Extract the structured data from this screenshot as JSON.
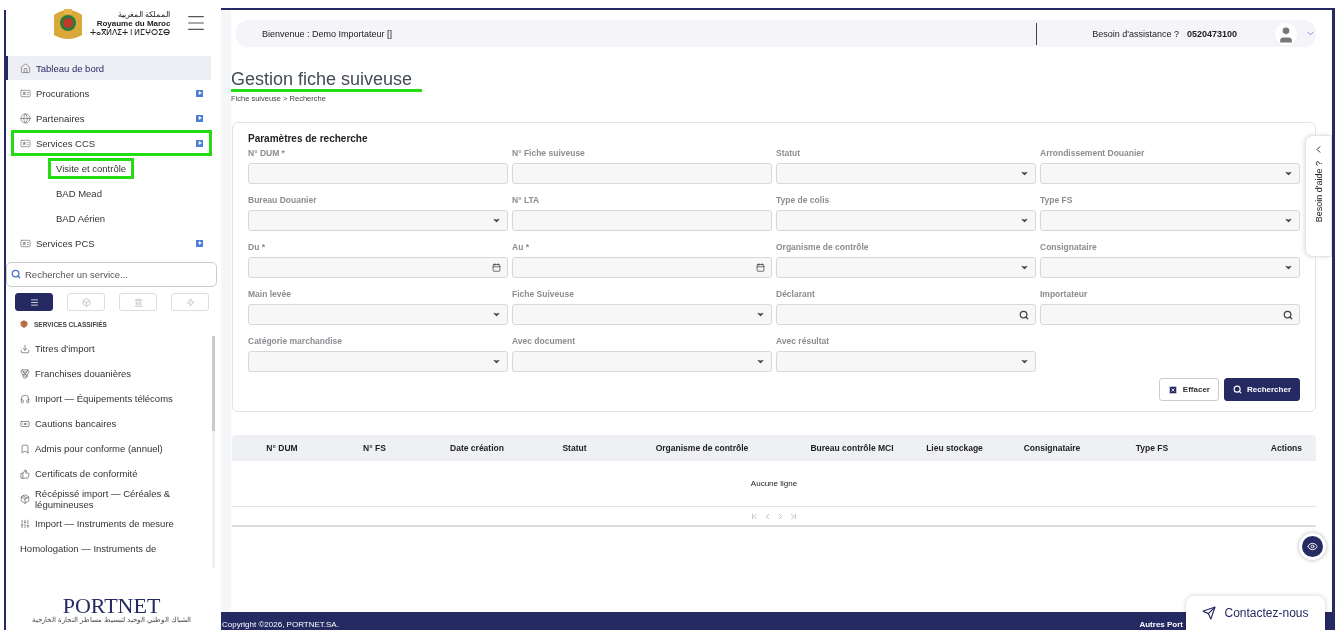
{
  "brand": {
    "arabic": "المملكة المغربية",
    "french": "Royaume du Maroc",
    "tifinagh": "ⵜⴰⴳⵍⴷⵉⵜ ⵏ ⵍⵎⵖⵔⵉⴱ"
  },
  "sidebar": {
    "menu": [
      {
        "label": "Tableau de bord",
        "selected": true,
        "highlighted": false,
        "expandable": false
      },
      {
        "label": "Procurations",
        "selected": false,
        "highlighted": false,
        "expandable": true
      },
      {
        "label": "Partenaires",
        "selected": false,
        "highlighted": false,
        "expandable": true
      },
      {
        "label": "Services CCS",
        "selected": false,
        "highlighted": true,
        "expandable": true,
        "children": [
          {
            "label": "Visite et contrôle",
            "highlighted": true
          },
          {
            "label": "BAD Mead",
            "highlighted": false
          },
          {
            "label": "BAD Aérien",
            "highlighted": false
          }
        ]
      },
      {
        "label": "Services PCS",
        "selected": false,
        "highlighted": false,
        "expandable": true
      }
    ],
    "search": {
      "placeholder": "Rechercher un service..."
    },
    "view_tabs": [
      {
        "selected": true
      },
      {
        "selected": false
      },
      {
        "selected": false
      },
      {
        "selected": false
      }
    ],
    "section_title": "SERVICES CLASSIFIÉS",
    "services": [
      "Titres d'import",
      "Franchises douanières",
      "Import — Équipements télécoms",
      "Cautions bancaires",
      "Admis pour conforme (annuel)",
      "Certificats de conformité",
      "Récépissé import — Céréales & légumineuses",
      "Import — Instruments de mesure",
      "Homologation — Instruments de"
    ],
    "footer_logo": {
      "name": "PORTNET",
      "subtitle": "الشباك الوطني الوحيد لتبسيط مساطر التجارة الخارجية"
    }
  },
  "header": {
    "welcome": "Bienvenue : Demo Importateur []",
    "help_label": "Besoin d'assistance ?",
    "phone": "0520473100"
  },
  "page": {
    "title": "Gestion fiche suiveuse",
    "title_highlighted": true,
    "breadcrumb": "Fiche suiveuse > Recherche"
  },
  "search_panel": {
    "title": "Paramètres de recherche",
    "fields": [
      {
        "label": "N° DUM *",
        "kind": "text"
      },
      {
        "label": "N° Fiche suiveuse",
        "kind": "text"
      },
      {
        "label": "Statut",
        "kind": "select"
      },
      {
        "label": "Arrondissement Douanier",
        "kind": "select"
      },
      {
        "label": "Bureau Douanier",
        "kind": "select"
      },
      {
        "label": "N° LTA",
        "kind": "text"
      },
      {
        "label": "Type de colis",
        "kind": "select"
      },
      {
        "label": "Type FS",
        "kind": "select"
      },
      {
        "label": "Du *",
        "kind": "date"
      },
      {
        "label": "Au *",
        "kind": "date"
      },
      {
        "label": "Organisme de contrôle",
        "kind": "select"
      },
      {
        "label": "Consignataire",
        "kind": "select"
      },
      {
        "label": "Main levée",
        "kind": "select"
      },
      {
        "label": "Fiche Suiveuse",
        "kind": "select"
      },
      {
        "label": "Déclarant",
        "kind": "search"
      },
      {
        "label": "Importateur",
        "kind": "search"
      },
      {
        "label": "Catégorie marchandise",
        "kind": "select"
      },
      {
        "label": "Avec document",
        "kind": "select"
      },
      {
        "label": "Avec résultat",
        "kind": "select"
      }
    ],
    "buttons": [
      {
        "label": "Effacer",
        "kind": "secondary"
      },
      {
        "label": "Rechercher",
        "kind": "primary"
      }
    ]
  },
  "table": {
    "columns": [
      "N° DUM",
      "N° FS",
      "Date création",
      "Statut",
      "Organisme de contrôle",
      "Bureau contrôle MCI",
      "Lieu stockage",
      "Consignataire",
      "Type FS",
      "Actions"
    ],
    "empty_message": "Aucune ligne"
  },
  "help_tab": "Besoin d'aide ?",
  "contact_button": "Contactez-nous",
  "footer": {
    "copyright": "Copyright ©2026, PORTNET.SA.",
    "right_link": "Autres Port"
  }
}
